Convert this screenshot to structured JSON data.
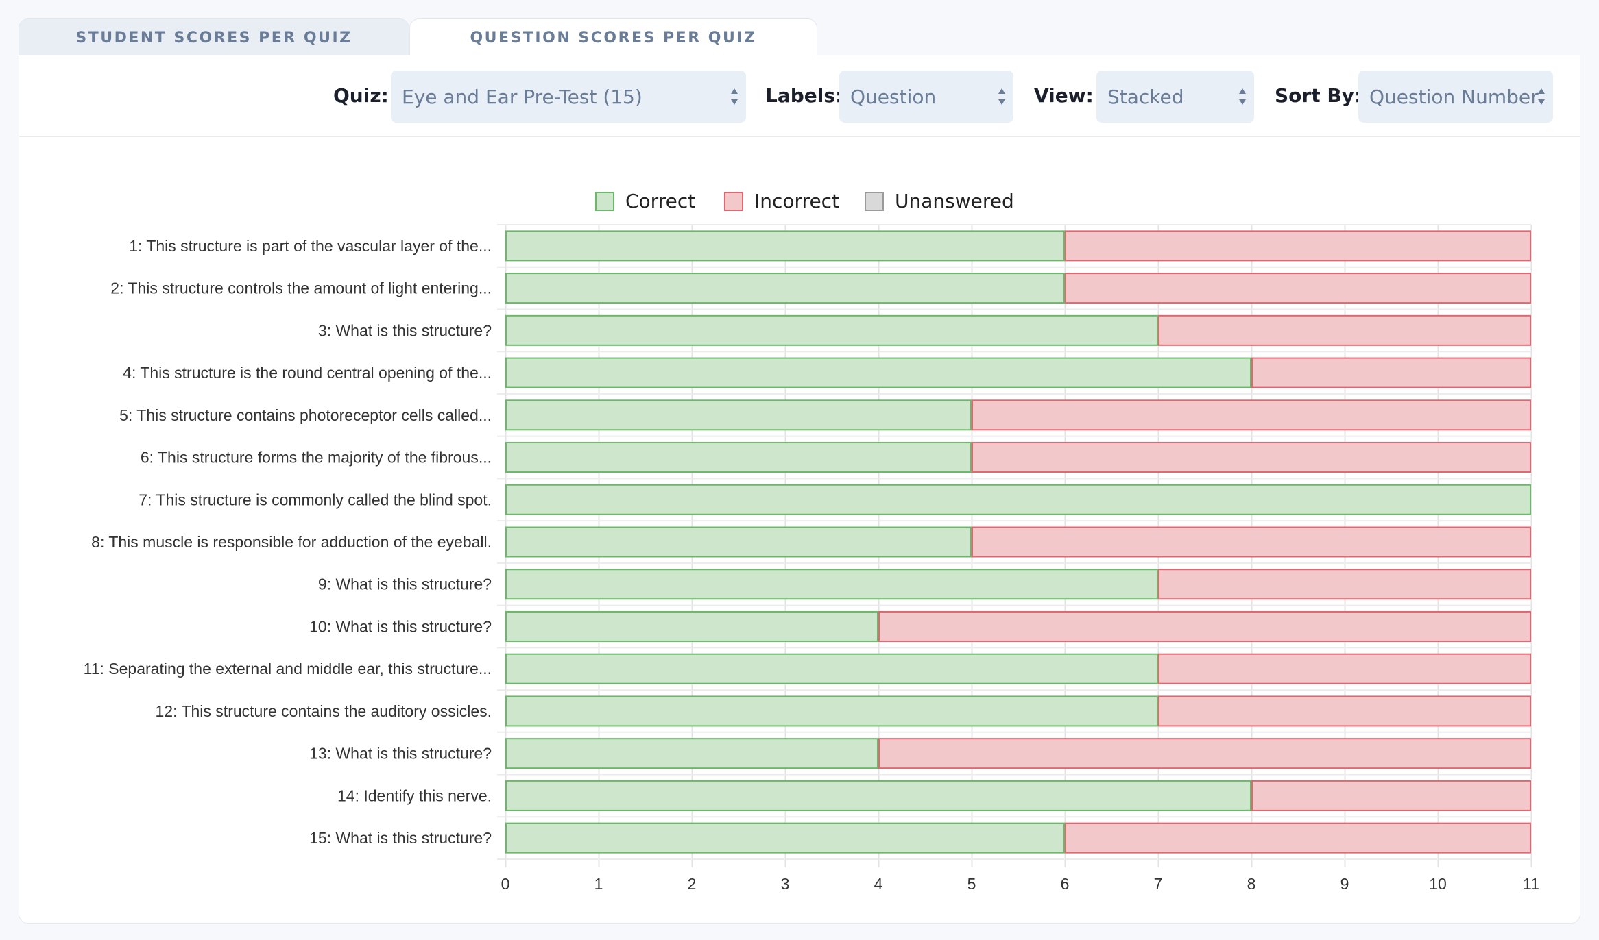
{
  "tabs": [
    {
      "label": "STUDENT SCORES PER QUIZ",
      "active": false
    },
    {
      "label": "QUESTION SCORES PER QUIZ",
      "active": true
    }
  ],
  "controls": {
    "quiz_label": "Quiz:",
    "quiz_value": "Eye and Ear Pre-Test (15)",
    "labels_label": "Labels:",
    "labels_value": "Question",
    "view_label": "View:",
    "view_value": "Stacked",
    "sort_label": "Sort By:",
    "sort_value": "Question Number"
  },
  "colors": {
    "correct_fill": "#cde6cc",
    "correct_stroke": "#6bb86a",
    "incorrect_fill": "#f2c8cb",
    "incorrect_stroke": "#e06670",
    "unanswered_fill": "#d9d9d9",
    "unanswered_stroke": "#9a9a9a"
  },
  "chart_data": {
    "type": "bar",
    "orientation": "horizontal",
    "stacked": true,
    "categories": [
      "1: This structure is part of the vascular layer of the...",
      "2: This structure controls the amount of light entering...",
      "3: What is this structure?",
      "4: This structure is the round central opening of the...",
      "5: This structure contains photoreceptor cells called...",
      "6: This structure forms the majority of the fibrous...",
      "7: This structure is commonly called the blind spot.",
      "8: This muscle is responsible for adduction of the eyeball.",
      "9: What is this structure?",
      "10: What is this structure?",
      "11: Separating the external and middle ear, this structure...",
      "12: This structure contains the auditory ossicles.",
      "13: What is this structure?",
      "14: Identify this nerve.",
      "15: What is this structure?"
    ],
    "series": [
      {
        "name": "Correct",
        "values": [
          6,
          6,
          7,
          8,
          5,
          5,
          11,
          5,
          7,
          4,
          7,
          7,
          4,
          8,
          6
        ]
      },
      {
        "name": "Incorrect",
        "values": [
          5,
          5,
          4,
          3,
          6,
          6,
          0,
          6,
          4,
          7,
          4,
          4,
          7,
          3,
          5
        ]
      },
      {
        "name": "Unanswered",
        "values": [
          0,
          0,
          0,
          0,
          0,
          0,
          0,
          0,
          0,
          0,
          0,
          0,
          0,
          0,
          0
        ]
      }
    ],
    "xlim": [
      0,
      11
    ],
    "xticks": [
      "0",
      "1",
      "2",
      "3",
      "4",
      "5",
      "6",
      "7",
      "8",
      "9",
      "10",
      "11"
    ],
    "grid": true,
    "legend_position": "top"
  }
}
